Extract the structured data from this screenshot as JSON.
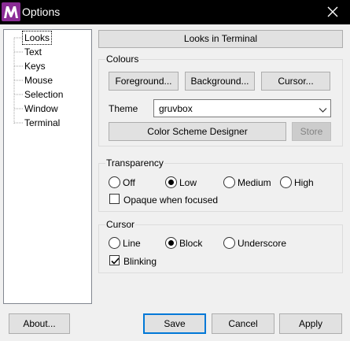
{
  "window": {
    "title": "Options",
    "app_icon_letter": "M"
  },
  "tree": {
    "items": [
      {
        "label": "Looks",
        "selected": true
      },
      {
        "label": "Text",
        "selected": false
      },
      {
        "label": "Keys",
        "selected": false
      },
      {
        "label": "Mouse",
        "selected": false
      },
      {
        "label": "Selection",
        "selected": false
      },
      {
        "label": "Window",
        "selected": false
      },
      {
        "label": "Terminal",
        "selected": false
      }
    ]
  },
  "header": {
    "label": "Looks in Terminal"
  },
  "colours": {
    "title": "Colours",
    "foreground_label": "Foreground...",
    "background_label": "Background...",
    "cursor_label": "Cursor...",
    "theme_label": "Theme",
    "theme_value": "gruvbox",
    "designer_label": "Color Scheme Designer",
    "store_label": "Store"
  },
  "transparency": {
    "title": "Transparency",
    "options": [
      {
        "label": "Off",
        "checked": false
      },
      {
        "label": "Low",
        "checked": true
      },
      {
        "label": "Medium",
        "checked": false
      },
      {
        "label": "High",
        "checked": false
      }
    ],
    "opaque_label": "Opaque when focused",
    "opaque_checked": false
  },
  "cursor": {
    "title": "Cursor",
    "options": [
      {
        "label": "Line",
        "checked": false
      },
      {
        "label": "Block",
        "checked": true
      },
      {
        "label": "Underscore",
        "checked": false
      }
    ],
    "blinking_label": "Blinking",
    "blinking_checked": true
  },
  "footer": {
    "about_label": "About...",
    "save_label": "Save",
    "cancel_label": "Cancel",
    "apply_label": "Apply"
  },
  "colors": {
    "titlebar": "#000000",
    "app_icon": "#8a2c95",
    "focus_border": "#0078d7"
  }
}
